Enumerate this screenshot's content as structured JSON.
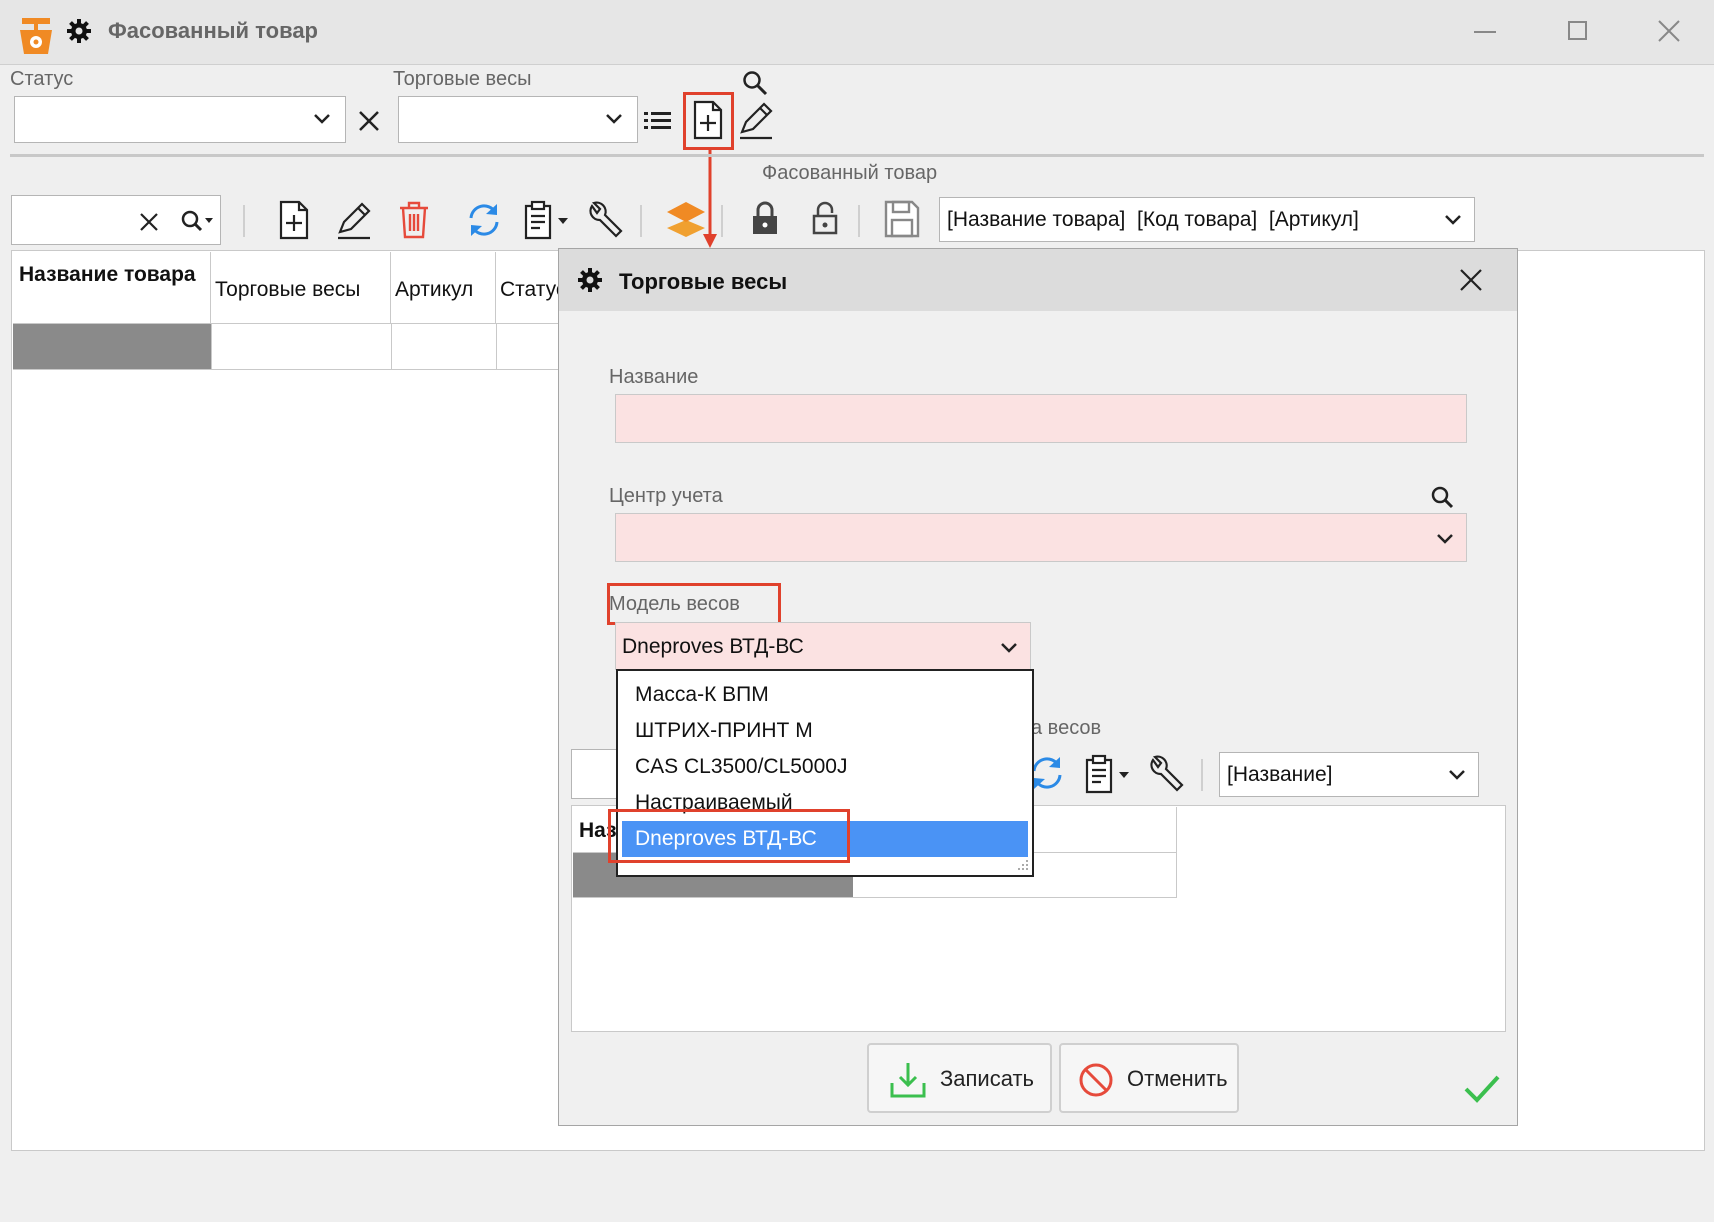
{
  "window": {
    "title": "Фасованный товар",
    "controls": [
      "minimize",
      "maximize",
      "close"
    ]
  },
  "filters": {
    "status_label": "Статус",
    "status_value": "",
    "scales_label": "Торговые весы",
    "scales_value": ""
  },
  "section_title": "Фасованный товар",
  "toolbar": {
    "search_value": "",
    "display_select": "[Название товара]  [Код товара]  [Артикул]"
  },
  "grid": {
    "columns": [
      "Название товара",
      "Торговые весы",
      "Артикул",
      "Статус"
    ]
  },
  "dialog": {
    "title": "Торговые весы",
    "name_label": "Название",
    "name_value": "",
    "center_label": "Центр учета",
    "center_value": "",
    "model_label": "Модель весов",
    "model_value": "Dneproves ВТД-ВС",
    "model_options": [
      "Масса-К ВПМ",
      "ШТРИХ-ПРИНТ М",
      "CAS CL3500/CL5000J",
      "Настраиваемый",
      "Dneproves ВТД-ВС"
    ],
    "selected_option_index": 4,
    "partial_label": "а весов",
    "subgrid_select": "[Название]",
    "subgrid_header_partial": "Наз",
    "save_label": "Записать",
    "cancel_label": "Отменить"
  },
  "colors": {
    "accent": "#e0412c",
    "selection": "#4a93f5",
    "required_field": "#fbe2e2",
    "ok_check": "#3bbf4e"
  }
}
